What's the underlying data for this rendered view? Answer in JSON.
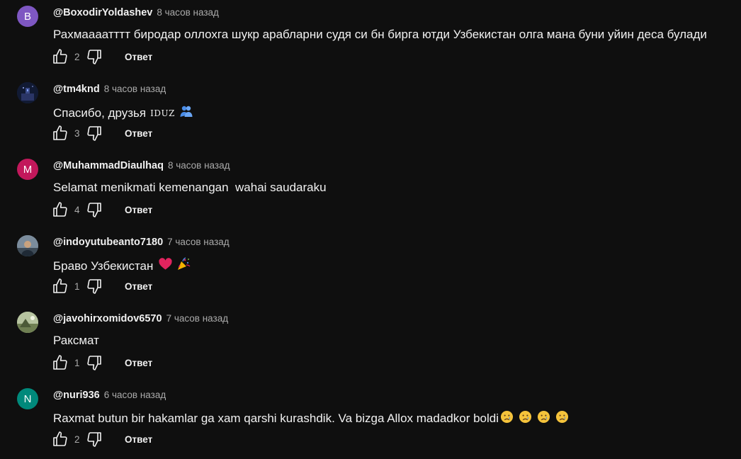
{
  "comments": [
    {
      "avatar": {
        "letter": "B",
        "color": "#7e57c2"
      },
      "author": "@BoxodirYoldashev",
      "time": "8 часов назад",
      "text": "Рахмаааатттт биродар оллохга шукр арабларни судя си бн бирга ютди Узбекистан олга мана буни уйин деса булади",
      "likes": "2",
      "reply": "Ответ"
    },
    {
      "avatar": {
        "letter": "",
        "color": "#1a2340",
        "icon": "photo-avatar-night"
      },
      "author": "@tm4knd",
      "time": "8 часов назад",
      "text": "Спасибо, друзья",
      "text_extra": "IDUZ",
      "emoji": "people-hugging",
      "likes": "3",
      "reply": "Ответ"
    },
    {
      "avatar": {
        "letter": "M",
        "color": "#c2185b"
      },
      "author": "@MuhammadDiaulhaq",
      "time": "8 часов назад",
      "text": "Selamat menikmati kemenangan  wahai saudaraku",
      "likes": "4",
      "reply": "Ответ"
    },
    {
      "avatar": {
        "letter": "",
        "color": "#5d6d7e",
        "icon": "photo-avatar-person"
      },
      "author": "@indoyutubeanto7180",
      "time": "7 часов назад",
      "text": "Браво Узбекистан",
      "emoji": "heart-party",
      "likes": "1",
      "reply": "Ответ"
    },
    {
      "avatar": {
        "letter": "",
        "color": "#8a9a6a",
        "icon": "photo-avatar-landscape"
      },
      "author": "@javohirxomidov6570",
      "time": "7 часов назад",
      "text": "Раксмат",
      "likes": "1",
      "reply": "Ответ"
    },
    {
      "avatar": {
        "letter": "N",
        "color": "#00897b"
      },
      "author": "@nuri936",
      "time": "6 часов назад",
      "text": "Raxmat butun bir hakamlar ga xam qarshi kurashdik. Va bizga Allox madadkor boldi",
      "emoji": "crying-faces",
      "likes": "2",
      "reply": "Ответ"
    }
  ]
}
